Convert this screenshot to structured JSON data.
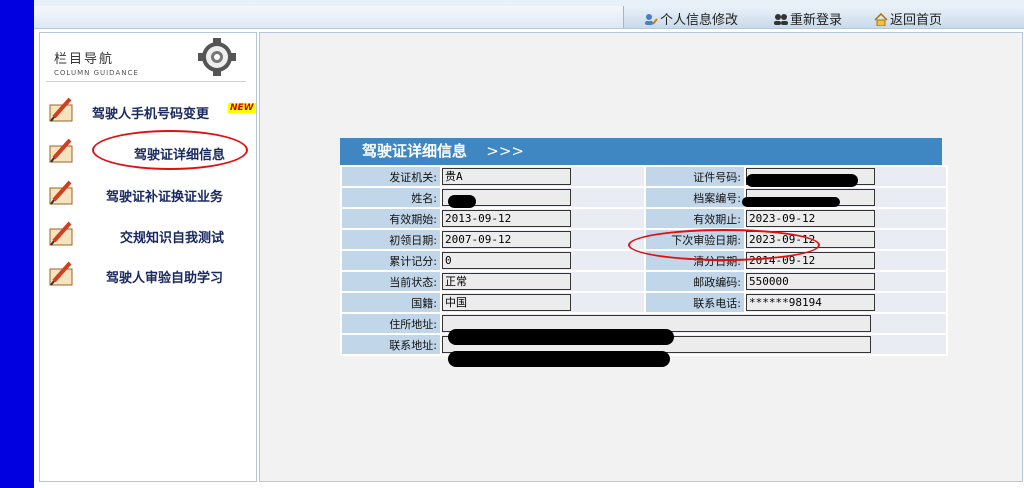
{
  "toolbar": {
    "personal_info": "个人信息修改",
    "relogin": "重新登录",
    "home": "返回首页"
  },
  "sidebar": {
    "title": "栏目导航",
    "subtitle": "COLUMN GUIDANCE",
    "items": [
      {
        "label": "驾驶人手机号码变更",
        "badge": "NEW"
      },
      {
        "label": "驾驶证详细信息"
      },
      {
        "label": "驾驶证补证换证业务"
      },
      {
        "label": "交规知识自我测试"
      },
      {
        "label": "驾驶人审验自助学习"
      }
    ]
  },
  "panel": {
    "title": "驾驶证详细信息",
    "arrows": ">>>",
    "fields": {
      "issuer": {
        "label": "发证机关:",
        "value": "贵A"
      },
      "cert_no": {
        "label": "证件号码:",
        "value": ""
      },
      "name": {
        "label": "姓名:",
        "value": ""
      },
      "file_no": {
        "label": "档案编号:",
        "value": ""
      },
      "valid_from": {
        "label": "有效期始:",
        "value": "2013-09-12"
      },
      "valid_to": {
        "label": "有效期止:",
        "value": "2023-09-12"
      },
      "first_date": {
        "label": "初领日期:",
        "value": "2007-09-12"
      },
      "next_review": {
        "label": "下次审验日期:",
        "value": "2023-09-12"
      },
      "points": {
        "label": "累计记分:",
        "value": "0"
      },
      "clear_date": {
        "label": "清分日期:",
        "value": "2014-09-12"
      },
      "status": {
        "label": "当前状态:",
        "value": "正常"
      },
      "postcode": {
        "label": "邮政编码:",
        "value": "550000"
      },
      "nationality": {
        "label": "国籍:",
        "value": "中国"
      },
      "phone": {
        "label": "联系电话:",
        "value": "******98194"
      },
      "address": {
        "label": "住所地址:",
        "value": ""
      },
      "contact_address": {
        "label": "联系地址:",
        "value": ""
      }
    }
  },
  "colors": {
    "header_blue": "#3f87c3",
    "label_bg": "#c2d6ea",
    "outer_blue": "#0000e0",
    "annotation_red": "#e01010"
  }
}
